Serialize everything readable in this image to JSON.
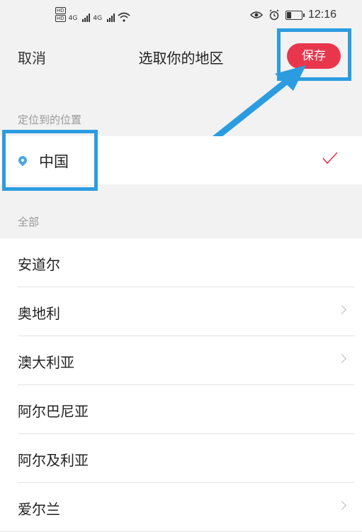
{
  "status_bar": {
    "hd1": "HD",
    "hd2": "HD",
    "net1": "4G",
    "net2": "4G",
    "time": "12:16",
    "battery_level": 0.35
  },
  "header": {
    "cancel_label": "取消",
    "title": "选取你的地区",
    "save_label": "保存"
  },
  "located": {
    "section_label": "定位到的位置",
    "country": "中国",
    "selected": true
  },
  "all": {
    "section_label": "全部",
    "items": [
      {
        "label": "安道尔",
        "chevron": false
      },
      {
        "label": "奥地利",
        "chevron": true
      },
      {
        "label": "澳大利亚",
        "chevron": true
      },
      {
        "label": "阿尔巴尼亚",
        "chevron": false
      },
      {
        "label": "阿尔及利亚",
        "chevron": false
      },
      {
        "label": "爱尔兰",
        "chevron": true
      }
    ]
  },
  "colors": {
    "accent": "#e8374d",
    "highlight": "#2c9ce0",
    "pin": "#48a7e6"
  }
}
